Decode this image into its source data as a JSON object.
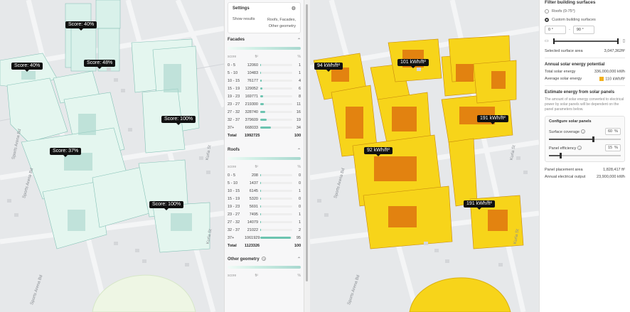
{
  "left_map": {
    "score_tags": [
      "Score: 40%",
      "Score: 40%",
      "Score: 48%",
      "Score: 100%",
      "Score: 37%",
      "Score: 100%"
    ],
    "streets": [
      "Sports Arena Bd",
      "Sports Arena Bd",
      "Kurla St",
      "Kurla St",
      "Sports Arena Bd"
    ]
  },
  "right_map": {
    "kwh_tags": [
      "94 kWh/ft²",
      "101 kWh/ft²",
      "191 kWh/ft²",
      "92 kWh/ft²",
      "191 kWh/ft²"
    ],
    "streets": [
      "Sports Arena Bd",
      "Kurla St",
      "Kurla St",
      "Sports Arena Bd"
    ]
  },
  "settings": {
    "title": "Settings",
    "show_results_label": "Show results",
    "show_results_value_1": "Roofs, Facades,",
    "show_results_value_2": "Other geometry",
    "settings_icon": "sliders-icon"
  },
  "facades": {
    "title": "Facades",
    "col_score": "score",
    "col_area": "ft²",
    "col_pct": "%",
    "rows": [
      {
        "score": "0 - 5",
        "area": "12060",
        "pct": "1",
        "fill": 1
      },
      {
        "score": "5 - 10",
        "area": "10483",
        "pct": "1",
        "fill": 1
      },
      {
        "score": "10 - 15",
        "area": "76177",
        "pct": "4",
        "fill": 4
      },
      {
        "score": "15 - 19",
        "area": "129052",
        "pct": "6",
        "fill": 6
      },
      {
        "score": "19 - 23",
        "area": "169771",
        "pct": "8",
        "fill": 8
      },
      {
        "score": "23 - 27",
        "area": "219300",
        "pct": "11",
        "fill": 11
      },
      {
        "score": "27 - 32",
        "area": "328740",
        "pct": "16",
        "fill": 16
      },
      {
        "score": "32 - 37",
        "area": "379609",
        "pct": "19",
        "fill": 19
      },
      {
        "score": "37+",
        "area": "668033",
        "pct": "34",
        "fill": 34
      }
    ],
    "total_label": "Total",
    "total_area": "1992725",
    "total_pct": "100"
  },
  "roofs": {
    "title": "Roofs",
    "col_score": "score",
    "col_area": "ft²",
    "col_pct": "%",
    "rows": [
      {
        "score": "0 - 5",
        "area": "208",
        "pct": "0",
        "fill": 0
      },
      {
        "score": "5 - 10",
        "area": "1437",
        "pct": "0",
        "fill": 0
      },
      {
        "score": "10 - 15",
        "area": "6145",
        "pct": "1",
        "fill": 1
      },
      {
        "score": "15 - 19",
        "area": "5320",
        "pct": "0",
        "fill": 0
      },
      {
        "score": "19 - 23",
        "area": "5691",
        "pct": "0",
        "fill": 0
      },
      {
        "score": "23 - 27",
        "area": "7495",
        "pct": "1",
        "fill": 1
      },
      {
        "score": "27 - 32",
        "area": "14079",
        "pct": "1",
        "fill": 1
      },
      {
        "score": "32 - 37",
        "area": "21022",
        "pct": "2",
        "fill": 2
      },
      {
        "score": "37+",
        "area": "1061929",
        "pct": "95",
        "fill": 95
      }
    ],
    "total_label": "Total",
    "total_area": "1123326",
    "total_pct": "100"
  },
  "other_geometry": {
    "title": "Other geometry",
    "col_score": "score",
    "col_area": "ft²",
    "col_pct": "%"
  },
  "right_panel": {
    "filter_title": "Filter building surfaces",
    "option_roofs": "Roofs (0-75°)",
    "option_custom": "Custom building surfaces",
    "range_min": "0 °",
    "range_sep": "-",
    "range_max": "90 °",
    "selected_area_label": "Selected surface area",
    "selected_area_value": "3,047,362ft²",
    "annual_title": "Annual solar energy potential",
    "total_energy_label": "Total solar energy",
    "total_energy_value": "336,000,000 kWh",
    "avg_energy_label": "Average solar energy",
    "avg_energy_value": "110 kWh/ft²",
    "estimate_title": "Estimate energy from solar panels",
    "estimate_note": "The amount of solar energy converted to electrical power by solar panels will be dependent on the panel parameters below.",
    "configure_title": "Configure solar panels",
    "coverage_label": "Surface coverage",
    "coverage_value": "60",
    "coverage_unit": "%",
    "coverage_level": 0.6,
    "efficiency_label": "Panel efficiency",
    "efficiency_value": "15",
    "efficiency_unit": "%",
    "efficiency_level": 0.15,
    "placement_label": "Panel placement area",
    "placement_value": "1,828,417 ft²",
    "output_label": "Annual electrical output",
    "output_value": "23,900,000 kWh"
  },
  "colors": {
    "facade_low": "#f2fbf7",
    "facade_high": "#8fd0c6",
    "solar_yellow": "#f7d41a",
    "solar_orange": "#e07a10",
    "map_bg": "#e6e8ea"
  }
}
